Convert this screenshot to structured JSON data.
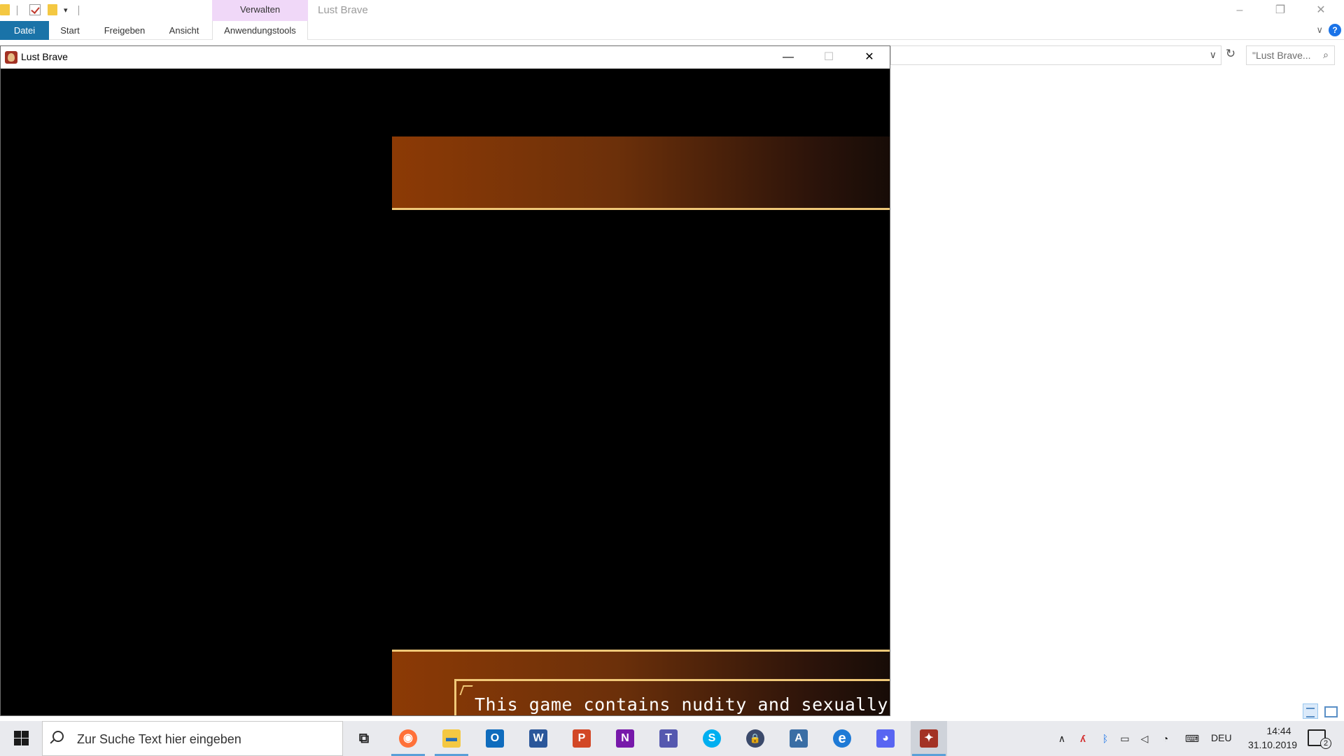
{
  "explorer": {
    "qat_dropdown": "▾",
    "contextual_group": "Verwalten",
    "window_title": "Lust Brave",
    "tabs": [
      {
        "label": "Datei"
      },
      {
        "label": "Start"
      },
      {
        "label": "Freigeben"
      },
      {
        "label": "Ansicht"
      },
      {
        "label": "Anwendungstools"
      }
    ],
    "controls": {
      "minimize": "–",
      "restore": "❐",
      "close": "✕"
    },
    "ribbon_chevron": "∨",
    "help": "?",
    "address_chevron": "∨",
    "refresh": "↻",
    "search_placeholder": "\"Lust Brave...",
    "search_icon": "⌕",
    "accent": "#1a73a8",
    "contextual_color": "#f0d8f8"
  },
  "game": {
    "title": "Lust Brave",
    "controls": {
      "minimize": "—",
      "maximize": "☐",
      "close": "✕"
    },
    "dialog_text": "This game contains nudity and sexually-expl",
    "banner_border_color": "#f0c878"
  },
  "taskbar": {
    "search_placeholder": "Zur Suche Text hier eingeben",
    "apps": [
      {
        "name": "task-view",
        "glyph": "⧉"
      },
      {
        "name": "firefox",
        "glyph": "◉",
        "color": "#ff7139"
      },
      {
        "name": "file-explorer",
        "glyph": "▬",
        "color": "#f4c842"
      },
      {
        "name": "outlook",
        "glyph": "O",
        "color": "#0f6cbd"
      },
      {
        "name": "word",
        "glyph": "W",
        "color": "#2b579a"
      },
      {
        "name": "powerpoint",
        "glyph": "P",
        "color": "#d24726"
      },
      {
        "name": "onenote",
        "glyph": "N",
        "color": "#7719aa"
      },
      {
        "name": "teams",
        "glyph": "T",
        "color": "#5558af"
      },
      {
        "name": "skype",
        "glyph": "S",
        "color": "#00aff0"
      },
      {
        "name": "keepass",
        "glyph": "🔒",
        "color": "#3b4a6b"
      },
      {
        "name": "font-app",
        "glyph": "A",
        "color": "#3a6ea5"
      },
      {
        "name": "edge",
        "glyph": "e",
        "color": "#1e7ad6"
      },
      {
        "name": "discord",
        "glyph": "◕",
        "color": "#5865f2"
      },
      {
        "name": "lust-brave",
        "glyph": "✦",
        "color": "#a33224"
      }
    ],
    "tray": {
      "chevron": "∧",
      "language": "DEU",
      "time": "14:44",
      "date": "31.10.2019",
      "notification_count": "2"
    }
  }
}
